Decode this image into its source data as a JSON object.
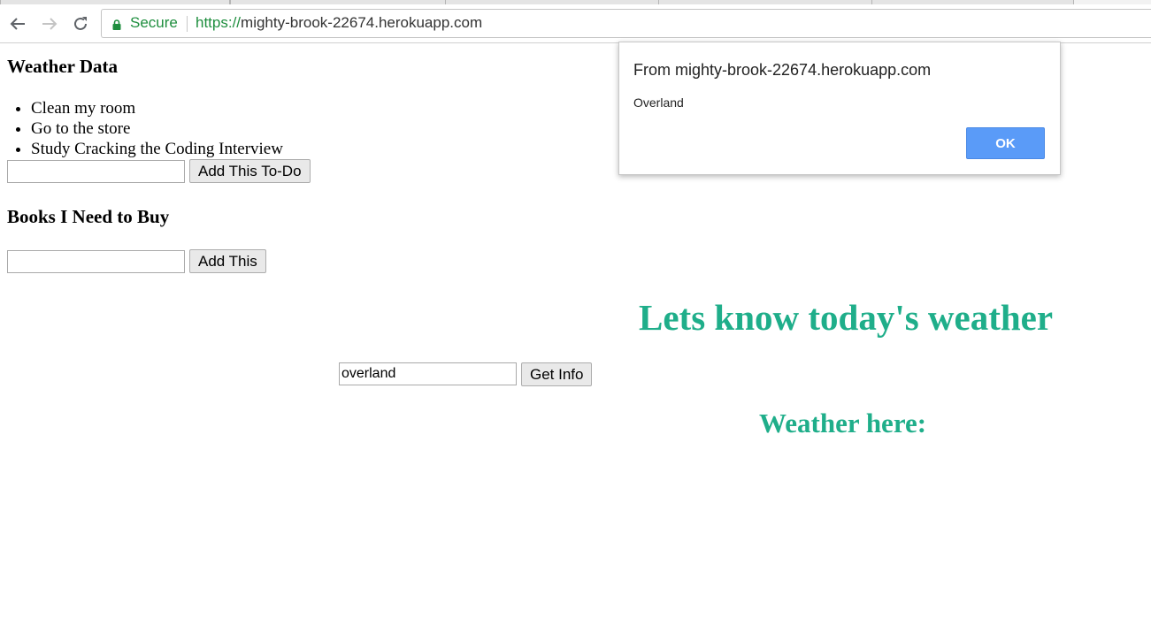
{
  "browser": {
    "secure_label": "Secure",
    "url_scheme": "https://",
    "url_host": "mighty-brook-22674.herokuapp.com"
  },
  "page": {
    "weather_data_heading": "Weather Data",
    "todos": [
      "Clean my room",
      "Go to the store",
      "Study Cracking the Coding Interview"
    ],
    "todo_input_value": "",
    "add_todo_button": "Add This To-Do",
    "books_heading": "Books I Need to Buy",
    "book_input_value": "",
    "add_book_button": "Add This",
    "weather_title": "Lets know today's weather",
    "city_input_value": "overland",
    "get_info_button": "Get Info",
    "weather_here_heading": "Weather here:"
  },
  "alert": {
    "title": "From mighty-brook-22674.herokuapp.com",
    "message": "Overland",
    "ok_button": "OK"
  },
  "colors": {
    "accent_green": "#1fae8a",
    "secure_green": "#1e8e3e",
    "dialog_button_blue": "#5a9bf8"
  },
  "icons": [
    "back-arrow-icon",
    "forward-arrow-icon",
    "reload-icon",
    "lock-icon"
  ]
}
